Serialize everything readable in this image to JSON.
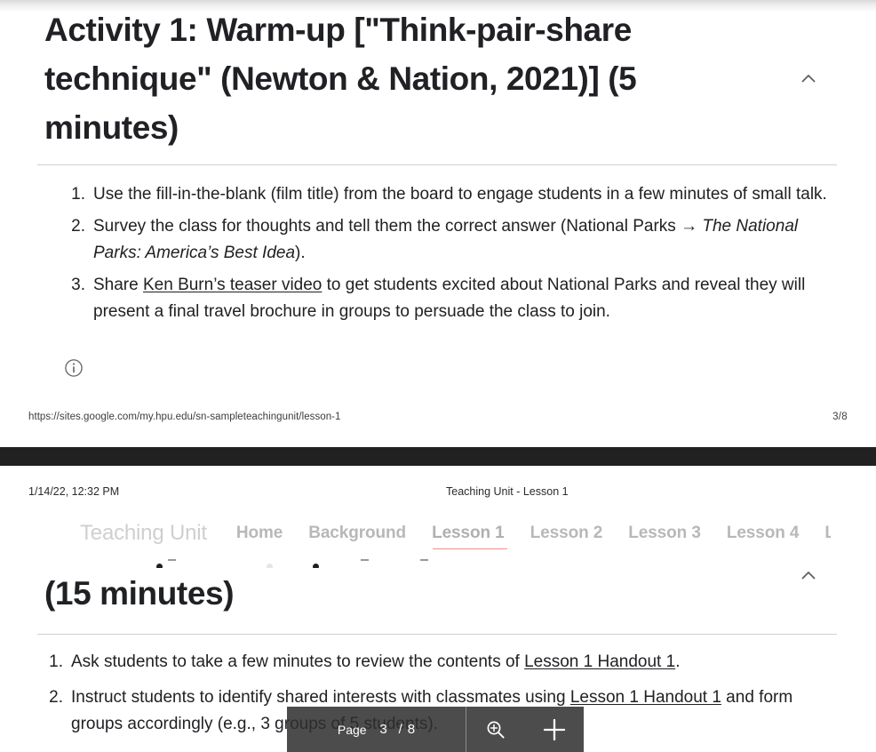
{
  "document": {
    "page_upper": {
      "heading": "Activity 1: Warm-up [\"Think-pair-share technique\" (Newton & Nation, 2021)] (5 minutes)",
      "collapse_icon": "chevron-up-icon",
      "info_icon": "info-circle-icon",
      "list": [
        {
          "marker": "1.",
          "segments": [
            {
              "text": "Use the fill-in-the-blank (film title) from the board to engage students in a few minutes of small talk.",
              "style": "plain"
            }
          ]
        },
        {
          "marker": "2.",
          "segments": [
            {
              "text": "Survey the class for thoughts and tell them the correct answer (National Parks → ",
              "style": "plain"
            },
            {
              "text": "The National Parks: America’s Best Idea",
              "style": "italic"
            },
            {
              "text": ").",
              "style": "plain"
            }
          ]
        },
        {
          "marker": "3.",
          "segments": [
            {
              "text": "Share ",
              "style": "plain"
            },
            {
              "text": "Ken Burn’s teaser video",
              "style": "link"
            },
            {
              "text": " to get students excited about National Parks and reveal they will present a final travel brochure in groups to persuade the class to join.",
              "style": "plain"
            }
          ]
        }
      ],
      "footer": {
        "url": "https://sites.google.com/my.hpu.edu/sn-sampleteachingunit/lesson-1",
        "page_label": "3/8"
      }
    },
    "page_lower": {
      "print_header": {
        "date": "1/14/22, 12:32 PM",
        "title": "Teaching Unit - Lesson 1"
      },
      "site_nav": {
        "brand": "Teaching Unit",
        "items": [
          {
            "label": "Home",
            "active": false
          },
          {
            "label": "Background",
            "active": false
          },
          {
            "label": "Lesson 1",
            "active": true
          },
          {
            "label": "Lesson 2",
            "active": false
          },
          {
            "label": "Lesson 3",
            "active": false
          },
          {
            "label": "Lesson 4",
            "active": false
          },
          {
            "label": "L",
            "active": false
          }
        ],
        "active_underline_color": "#ef8f8f"
      },
      "collapse_icon": "chevron-up-icon",
      "heading": "(15 minutes)",
      "list": [
        {
          "marker": "1.",
          "segments": [
            {
              "text": "Ask students to take a few minutes to review the contents of ",
              "style": "plain"
            },
            {
              "text": "Lesson 1 Handout 1",
              "style": "link"
            },
            {
              "text": ".",
              "style": "plain"
            }
          ]
        },
        {
          "marker": "2.",
          "segments": [
            {
              "text": "Instruct students to identify shared interests with classmates using ",
              "style": "plain"
            },
            {
              "text": "Lesson 1 Handout 1",
              "style": "link"
            },
            {
              "text": " and form groups accordingly (e.g., 3 groups of 5 students).",
              "style": "plain"
            }
          ]
        }
      ]
    }
  },
  "toolbar": {
    "page_label": "Page",
    "current_page": "3",
    "separator": "/",
    "total_pages": "8",
    "zoom_in_icon": "magnifier-plus-icon",
    "add_icon": "plus-icon",
    "background_color": "#2f2f2f"
  },
  "colors": {
    "page_gap": "#212121",
    "body_text": "#202124",
    "nav_inactive": "#b8b8b8",
    "nav_brand": "#cfcfcf",
    "accent": "#ef8f8f"
  }
}
